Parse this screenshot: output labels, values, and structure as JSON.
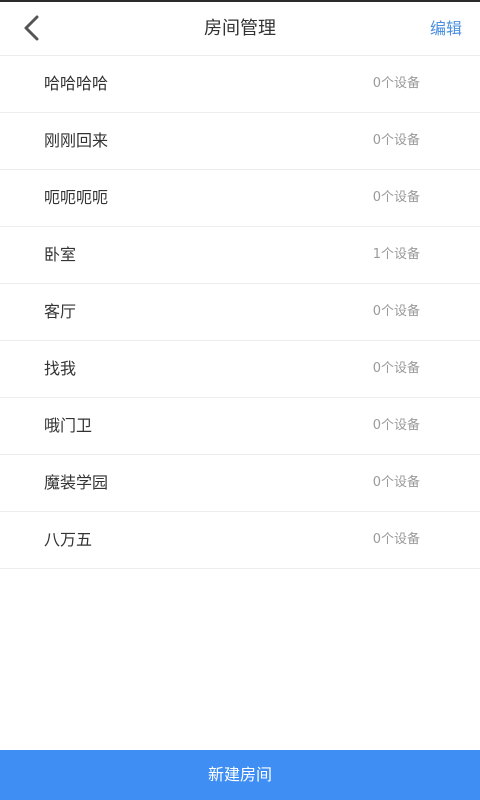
{
  "header": {
    "title": "房间管理",
    "edit_label": "编辑",
    "back_icon": "chevron-left-icon"
  },
  "rooms": [
    {
      "name": "哈哈哈哈",
      "device_count": "0个设备"
    },
    {
      "name": "刚刚回来",
      "device_count": "0个设备"
    },
    {
      "name": "呃呃呃呃",
      "device_count": "0个设备"
    },
    {
      "name": "卧室",
      "device_count": "1个设备"
    },
    {
      "name": "客厅",
      "device_count": "0个设备"
    },
    {
      "name": "找我",
      "device_count": "0个设备"
    },
    {
      "name": "哦门卫",
      "device_count": "0个设备"
    },
    {
      "name": "魔装学园",
      "device_count": "0个设备"
    },
    {
      "name": "八万五",
      "device_count": "0个设备"
    }
  ],
  "footer": {
    "new_room_label": "新建房间"
  },
  "colors": {
    "accent": "#4a8fe0",
    "footer_bg": "#3e8ef4"
  }
}
